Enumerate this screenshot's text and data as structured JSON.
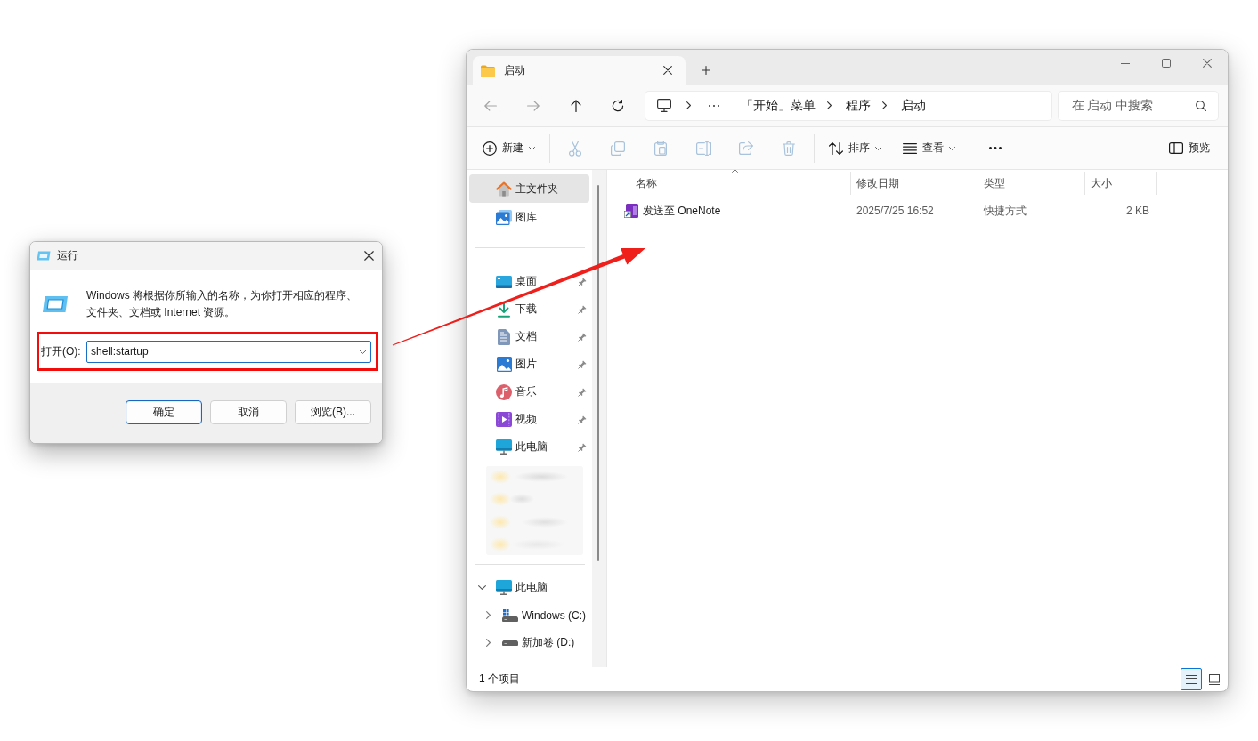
{
  "run_dialog": {
    "title": "运行",
    "description": "Windows 将根据你所输入的名称，为你打开相应的程序、文件夹、文档或 Internet 资源。",
    "open_label": "打开(O):",
    "command": {
      "value": "shell:startup",
      "focused": true
    },
    "open_row_highlighted": true,
    "buttons": [
      {
        "label": "确定",
        "default": true
      },
      {
        "label": "取消",
        "default": false
      },
      {
        "label": "浏览(B)...",
        "default": false
      }
    ]
  },
  "annotation_arrow": true,
  "explorer": {
    "tabs": [
      {
        "label": "启动",
        "selected": true
      }
    ],
    "nav_buttons": [
      {
        "kind": "back",
        "disabled": true
      },
      {
        "kind": "forward",
        "disabled": true
      },
      {
        "kind": "up",
        "disabled": false
      },
      {
        "kind": "refresh",
        "disabled": false
      }
    ],
    "breadcrumb": [
      "「开始」菜单",
      "程序",
      "启动"
    ],
    "search": {
      "placeholder": "在 启动 中搜索"
    },
    "toolbar": {
      "groups": [
        [
          {
            "kind": "new",
            "label": "新建",
            "dropdown": true,
            "disabled": false
          }
        ],
        [
          {
            "kind": "cut",
            "disabled": true
          },
          {
            "kind": "copy",
            "disabled": true
          },
          {
            "kind": "paste",
            "disabled": true
          },
          {
            "kind": "rename",
            "disabled": true
          },
          {
            "kind": "share",
            "disabled": true
          },
          {
            "kind": "delete",
            "disabled": true
          }
        ],
        [
          {
            "kind": "sort",
            "label": "排序",
            "dropdown": true,
            "disabled": false
          },
          {
            "kind": "view",
            "label": "查看",
            "dropdown": true,
            "disabled": false
          }
        ],
        [
          {
            "kind": "more",
            "disabled": false
          }
        ]
      ],
      "right": [
        {
          "kind": "preview",
          "label": "预览",
          "disabled": false
        }
      ]
    },
    "sidebar": {
      "sections": [
        {
          "items": [
            {
              "kind": "home",
              "label": "主文件夹",
              "selected": true
            },
            {
              "kind": "gallery",
              "label": "图库",
              "selected": false
            }
          ]
        },
        {
          "items": [
            {
              "kind": "desktop",
              "label": "桌面",
              "selected": false,
              "pinned": true
            },
            {
              "kind": "downloads",
              "label": "下载",
              "selected": false,
              "pinned": true
            },
            {
              "kind": "documents",
              "label": "文档",
              "selected": false,
              "pinned": true
            },
            {
              "kind": "pictures",
              "label": "图片",
              "selected": false,
              "pinned": true
            },
            {
              "kind": "music",
              "label": "音乐",
              "selected": false,
              "pinned": true
            },
            {
              "kind": "videos",
              "label": "视频",
              "selected": false,
              "pinned": true
            },
            {
              "kind": "pc",
              "label": "此电脑",
              "selected": false,
              "pinned": true
            }
          ],
          "blurred_rows": true
        },
        {
          "tree": [
            {
              "kind": "pc",
              "label": "此电脑",
              "selected": false,
              "expanded": true,
              "children": [
                {
                  "kind": "system-drive",
                  "label": "Windows (C:)",
                  "selected": false,
                  "expanded": false
                },
                {
                  "kind": "drive",
                  "label": "新加卷 (D:)",
                  "selected": false,
                  "expanded": false
                }
              ]
            }
          ]
        }
      ]
    },
    "file_list": {
      "columns": [
        {
          "label": "名称",
          "sorted": true
        },
        {
          "label": "修改日期",
          "sorted": false
        },
        {
          "label": "类型",
          "sorted": false
        },
        {
          "label": "大小",
          "sorted": false
        }
      ],
      "rows": [
        {
          "name": "发送至 OneNote",
          "modified": "2025/7/25 16:52",
          "type": "快捷方式",
          "size": "2 KB"
        }
      ]
    },
    "status_bar": {
      "item_count": "1 个项目",
      "view_buttons": [
        {
          "kind": "details",
          "selected": true
        },
        {
          "kind": "tiles",
          "selected": false
        }
      ]
    }
  }
}
